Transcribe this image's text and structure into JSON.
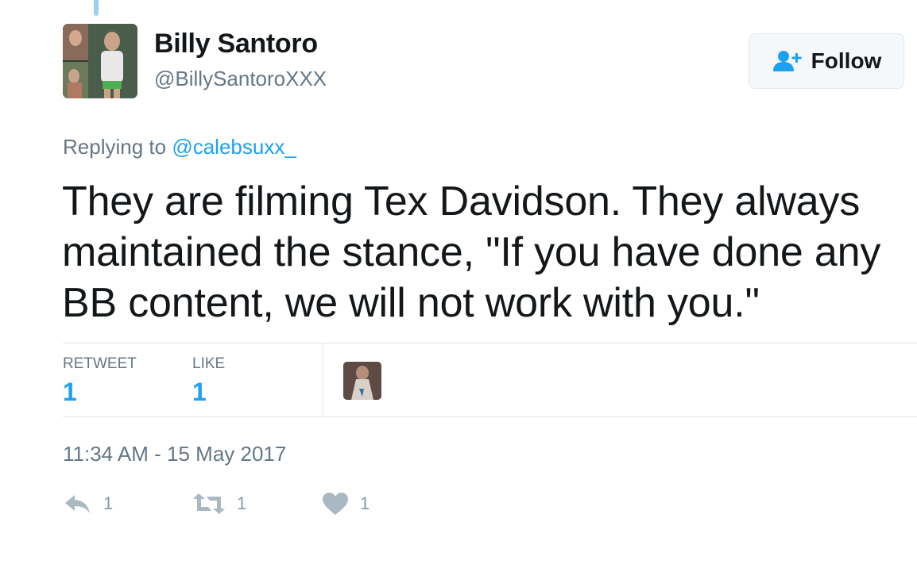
{
  "colors": {
    "accent": "#1da1f2",
    "text": "#14171a",
    "muted": "#657786",
    "icon": "#aab8c2"
  },
  "author": {
    "name": "Billy Santoro",
    "handle": "@BillySantoroXXX",
    "avatar_icon": "profile-photo"
  },
  "follow_button": {
    "icon": "add-user-icon",
    "label": "Follow"
  },
  "reply_context": {
    "prefix": "Replying to",
    "mention": "@calebsuxx_"
  },
  "tweet": {
    "text": "They are filming Tex Davidson.  They always maintained the stance, \"If you have done any BB content, we will not work with you.\""
  },
  "stats": {
    "retweet_label": "RETWEET",
    "retweet_count": "1",
    "like_label": "LIKE",
    "like_count": "1",
    "liker_avatar_icon": "liker-profile-photo"
  },
  "timestamp": "11:34 AM - 15 May 2017",
  "actions": {
    "reply_count": "1",
    "retweet_count": "1",
    "like_count": "1"
  }
}
